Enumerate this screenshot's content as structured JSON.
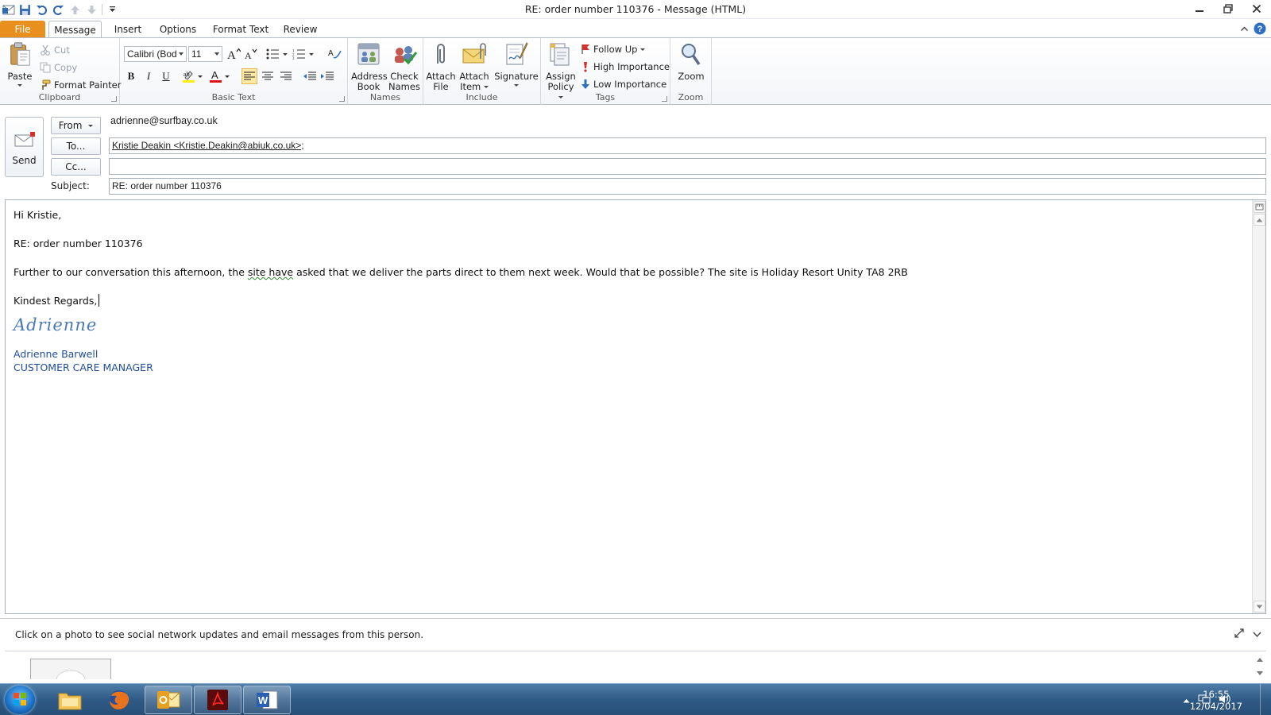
{
  "window": {
    "title": "RE:  order number 110376  -  Message (HTML)"
  },
  "ribbon_tabs": [
    {
      "label": "File"
    },
    {
      "label": "Message"
    },
    {
      "label": "Insert"
    },
    {
      "label": "Options"
    },
    {
      "label": "Format Text"
    },
    {
      "label": "Review"
    }
  ],
  "clipboard": {
    "paste": "Paste",
    "cut": "Cut",
    "copy": "Copy",
    "format_painter": "Format Painter",
    "group_label": "Clipboard"
  },
  "basic_text": {
    "font_name": "Calibri (Bod",
    "font_size": "11",
    "bold": "B",
    "italic": "I",
    "underline": "U",
    "font_color_letter": "A",
    "group_label": "Basic Text"
  },
  "names": {
    "address_book_1": "Address",
    "address_book_2": "Book",
    "check_names_1": "Check",
    "check_names_2": "Names",
    "group_label": "Names"
  },
  "include": {
    "attach_file_1": "Attach",
    "attach_file_2": "File",
    "attach_item_1": "Attach",
    "attach_item_2": "Item",
    "signature": "Signature",
    "group_label": "Include"
  },
  "tags": {
    "assign_policy_1": "Assign",
    "assign_policy_2": "Policy",
    "follow_up": "Follow Up",
    "high_importance": "High Importance",
    "low_importance": "Low Importance",
    "group_label": "Tags"
  },
  "zoom": {
    "zoom": "Zoom",
    "group_label": "Zoom"
  },
  "header": {
    "send": "Send",
    "from_label": "From",
    "from_value": "adrienne@surfbay.co.uk",
    "to_label": "To...",
    "to_value": "Kristie Deakin  <Kristie.Deakin@abiuk.co.uk>;",
    "cc_label": "Cc...",
    "cc_value": "",
    "subject_label": "Subject:",
    "subject_value": "RE:  order number 110376"
  },
  "body": {
    "greeting": "Hi Kristie,",
    "re_line": "RE:  order number 110376",
    "para_part1": "Further to our conversation this afternoon, the ",
    "para_squiggle": "site have",
    "para_part2": " asked that we deliver the parts direct to them next week.  Would that be possible?  The site is Holiday Resort Unity TA8 2RB",
    "closing": "Kindest Regards,",
    "signature_script": "Adrienne",
    "signature_name": "Adrienne Barwell",
    "signature_title": "CUSTOMER CARE MANAGER"
  },
  "people_pane": {
    "message": "Click on a photo to see social network updates and email messages from this person."
  },
  "taskbar": {
    "time": "16:55",
    "date": "12/04/2017"
  }
}
